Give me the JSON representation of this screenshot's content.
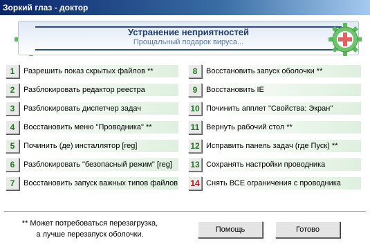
{
  "window": {
    "title": "Зоркий глаз - доктор"
  },
  "banner": {
    "title": "Устранение неприятностей",
    "subtitle": "Прощальный подарок вируса..."
  },
  "logo": {
    "icon": "green-gear-red-cross-icon"
  },
  "colors": {
    "number_green": "#1f7a1f",
    "number_red": "#b01212",
    "banner_text": "#1f3b68"
  },
  "actions_left": [
    {
      "num": "1",
      "label": "Разрешить показ скрытых файлов **"
    },
    {
      "num": "2",
      "label": "Разблокировать редактор реестра"
    },
    {
      "num": "3",
      "label": "Разблокировать диспетчер задач"
    },
    {
      "num": "4",
      "label": "Восстановить меню \"Проводника\" **"
    },
    {
      "num": "5",
      "label": "Починить (де) инсталлятор [reg]"
    },
    {
      "num": "6",
      "label": "Разблокировать \"безопасный режим\" [reg]"
    },
    {
      "num": "7",
      "label": "Восстановить запуск важных типов файлов"
    }
  ],
  "actions_right": [
    {
      "num": "8",
      "label": "Восстановить запуск оболочки **"
    },
    {
      "num": "9",
      "label": "Восстановить IE"
    },
    {
      "num": "10",
      "label": "Починить апплет \"Свойства: Экран\""
    },
    {
      "num": "11",
      "label": "Вернуть рабочий стол **"
    },
    {
      "num": "12",
      "label": "Исправить панель задач (где Пуск) **"
    },
    {
      "num": "13",
      "label": "Сохранять настройки проводника"
    },
    {
      "num": "14",
      "label": "Снять ВСЕ ограничения с проводника"
    }
  ],
  "footer": {
    "note_line1": "** Может потребоваться перезагрузка,",
    "note_line2": "а лучше перезапуск оболочки.",
    "help_label": "Помощь",
    "done_label": "Готово"
  }
}
